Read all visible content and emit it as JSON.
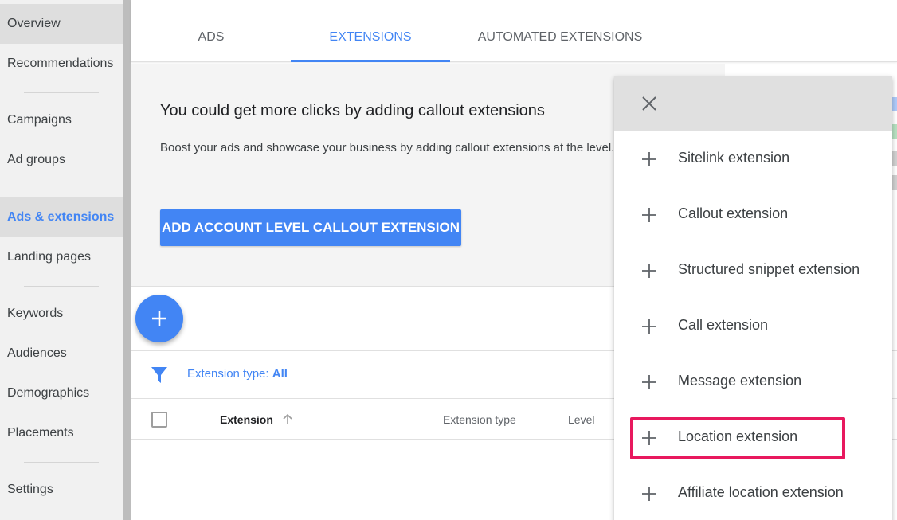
{
  "sidebar": {
    "items": [
      {
        "label": "Overview",
        "state": "selected"
      },
      {
        "label": "Recommendations"
      },
      {
        "label": "Campaigns"
      },
      {
        "label": "Ad groups"
      },
      {
        "label": "Ads & extensions",
        "state": "active"
      },
      {
        "label": "Landing pages"
      },
      {
        "label": "Keywords"
      },
      {
        "label": "Audiences"
      },
      {
        "label": "Demographics"
      },
      {
        "label": "Placements"
      },
      {
        "label": "Settings"
      }
    ]
  },
  "tabs": [
    {
      "label": "ADS"
    },
    {
      "label": "EXTENSIONS",
      "active": true
    },
    {
      "label": "AUTOMATED EXTENSIONS"
    }
  ],
  "recommendation": {
    "title": "You could get more clicks by adding callout extensions",
    "description": "Boost your ads and showcase your business by adding callout extensions at the level.",
    "button_label": "ADD ACCOUNT LEVEL CALLOUT EXTENSION"
  },
  "filter": {
    "label": "Extension type: ",
    "value": "All"
  },
  "table": {
    "columns": [
      "Extension",
      "Extension type",
      "Level"
    ]
  },
  "menu": {
    "items": [
      {
        "label": "Sitelink extension"
      },
      {
        "label": "Callout extension"
      },
      {
        "label": "Structured snippet extension"
      },
      {
        "label": "Call extension"
      },
      {
        "label": "Message extension"
      },
      {
        "label": "Location extension",
        "highlighted": true
      },
      {
        "label": "Affiliate location extension"
      }
    ]
  },
  "colors": {
    "accent": "#4285f4",
    "highlight": "#e8185e"
  },
  "icons": [
    "close-icon",
    "plus-icon",
    "filter-icon",
    "arrow-up-icon",
    "add-icon"
  ]
}
